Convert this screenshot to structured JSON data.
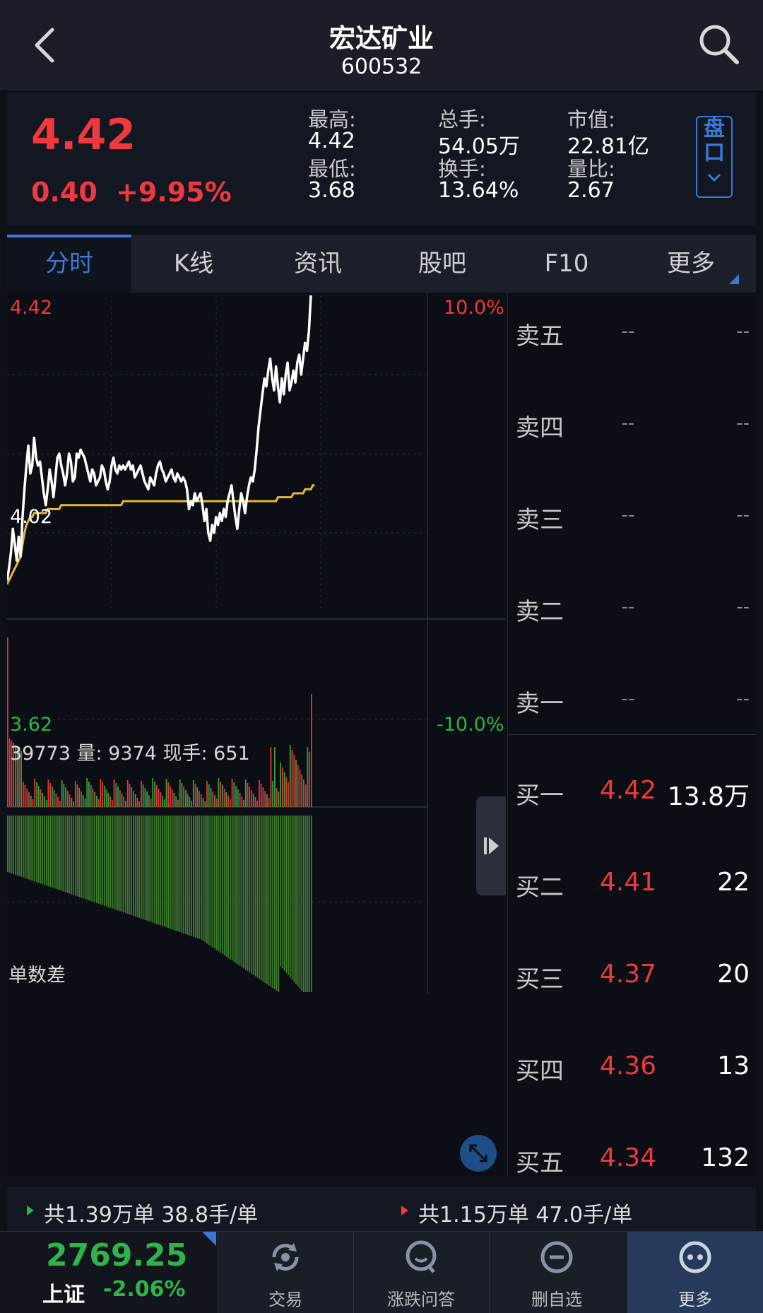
{
  "header": {
    "stock_name": "宏达矿业",
    "stock_code": "600532",
    "back_icon": "chevron-left-icon",
    "search_icon": "search-icon"
  },
  "quote": {
    "price": "4.42",
    "change": "0.40",
    "change_pct": "+9.95%",
    "stats": [
      {
        "label": "最高:",
        "value": "4.42"
      },
      {
        "label": "最低:",
        "value": "3.68"
      },
      {
        "label": "总手:",
        "value": "54.05万"
      },
      {
        "label": "换手:",
        "value": "13.64%"
      },
      {
        "label": "市值:",
        "value": "22.81亿"
      },
      {
        "label": "量比:",
        "value": "2.67"
      }
    ],
    "pankou_chars": [
      "盘",
      "口"
    ],
    "colors": {
      "up": "#f0393e",
      "down": "#2fb34a",
      "accent": "#3d78d8"
    }
  },
  "tabs": [
    "分时",
    "K线",
    "资讯",
    "股吧",
    "F10",
    "更多"
  ],
  "active_tab": "分时",
  "chart_data": {
    "type": "line",
    "axis": {
      "price_top": "4.42",
      "price_mid": "4.02",
      "price_bottom": "3.62",
      "pct_top": "10.0%",
      "pct_bottom": "-10.0%"
    },
    "ylim": [
      3.62,
      4.42
    ],
    "volume_header": "39773  量: 9374  现手: 651",
    "diff_header": "单数差",
    "price": [
      3.7,
      3.73,
      3.77,
      3.83,
      3.79,
      3.75,
      3.81,
      3.76,
      3.86,
      3.93,
      3.99,
      4.04,
      3.97,
      3.99,
      4.06,
      4.01,
      3.99,
      4.0,
      3.96,
      3.92,
      3.89,
      3.93,
      3.98,
      3.95,
      3.91,
      3.96,
      4.01,
      4.02,
      3.99,
      3.97,
      3.94,
      3.97,
      4.02,
      4.0,
      3.95,
      3.96,
      4.02,
      4.01,
      4.03,
      4.02,
      4.01,
      3.99,
      3.97,
      3.95,
      3.98,
      3.97,
      3.94,
      3.95,
      3.96,
      3.99,
      3.98,
      3.95,
      3.93,
      3.95,
      3.99,
      4.01,
      3.98,
      3.97,
      3.99,
      3.98,
      3.99,
      3.98,
      3.99,
      4.0,
      3.98,
      3.99,
      3.96,
      3.97,
      3.98,
      3.99,
      3.97,
      3.95,
      3.94,
      3.93,
      3.96,
      3.95,
      3.94,
      3.97,
      3.99,
      4.0,
      3.98,
      3.97,
      3.95,
      3.96,
      3.97,
      3.98,
      3.96,
      3.95,
      3.97,
      3.96,
      3.95,
      3.96,
      3.95,
      3.93,
      3.88,
      3.9,
      3.89,
      3.92,
      3.9,
      3.91,
      3.92,
      3.89,
      3.85,
      3.88,
      3.82,
      3.8,
      3.84,
      3.82,
      3.86,
      3.84,
      3.87,
      3.85,
      3.88,
      3.86,
      3.9,
      3.92,
      3.94,
      3.9,
      3.86,
      3.83,
      3.88,
      3.92,
      3.9,
      3.87,
      3.91,
      3.94,
      3.96,
      3.95,
      3.98,
      4.03,
      4.09,
      4.13,
      4.17,
      4.21,
      4.19,
      4.23,
      4.26,
      4.21,
      4.18,
      4.24,
      4.19,
      4.15,
      4.21,
      4.17,
      4.22,
      4.25,
      4.18,
      4.2,
      4.23,
      4.2,
      4.25,
      4.27,
      4.22,
      4.26,
      4.3,
      4.28,
      4.33,
      4.42
    ],
    "avg_price": [
      3.69,
      3.7,
      3.71,
      3.72,
      3.73,
      3.74,
      3.75,
      3.76,
      3.79,
      3.82,
      3.84,
      3.85,
      3.86,
      3.86,
      3.87,
      3.87,
      3.87,
      3.87,
      3.87,
      3.87,
      3.87,
      3.88,
      3.88,
      3.88,
      3.88,
      3.88,
      3.88,
      3.88,
      3.89,
      3.89,
      3.89,
      3.89,
      3.89,
      3.89,
      3.89,
      3.89,
      3.89,
      3.89,
      3.89,
      3.89,
      3.89,
      3.89,
      3.89,
      3.89,
      3.89,
      3.89,
      3.89,
      3.89,
      3.89,
      3.89,
      3.89,
      3.89,
      3.89,
      3.89,
      3.89,
      3.89,
      3.89,
      3.89,
      3.89,
      3.89,
      3.9,
      3.9,
      3.9,
      3.9,
      3.9,
      3.9,
      3.9,
      3.9,
      3.9,
      3.9,
      3.9,
      3.9,
      3.9,
      3.9,
      3.9,
      3.9,
      3.9,
      3.9,
      3.9,
      3.9,
      3.9,
      3.9,
      3.9,
      3.9,
      3.9,
      3.9,
      3.9,
      3.9,
      3.9,
      3.9,
      3.9,
      3.9,
      3.9,
      3.9,
      3.9,
      3.9,
      3.9,
      3.9,
      3.9,
      3.9,
      3.9,
      3.9,
      3.9,
      3.9,
      3.9,
      3.9,
      3.9,
      3.9,
      3.9,
      3.9,
      3.9,
      3.9,
      3.9,
      3.9,
      3.9,
      3.9,
      3.9,
      3.9,
      3.9,
      3.9,
      3.9,
      3.9,
      3.9,
      3.9,
      3.9,
      3.9,
      3.9,
      3.9,
      3.9,
      3.9,
      3.9,
      3.9,
      3.9,
      3.9,
      3.9,
      3.9,
      3.9,
      3.9,
      3.9,
      3.9,
      3.91,
      3.91,
      3.91,
      3.91,
      3.91,
      3.91,
      3.91,
      3.91,
      3.92,
      3.92,
      3.92,
      3.92,
      3.92,
      3.92,
      3.93,
      3.93,
      3.93,
      3.93,
      3.94,
      3.94
    ]
  },
  "order_book": {
    "sell": [
      {
        "label": "卖五",
        "price": "--",
        "vol": "--"
      },
      {
        "label": "卖四",
        "price": "--",
        "vol": "--"
      },
      {
        "label": "卖三",
        "price": "--",
        "vol": "--"
      },
      {
        "label": "卖二",
        "price": "--",
        "vol": "--"
      },
      {
        "label": "卖一",
        "price": "--",
        "vol": "--"
      }
    ],
    "buy": [
      {
        "label": "买一",
        "price": "4.42",
        "vol": "13.8万"
      },
      {
        "label": "买二",
        "price": "4.41",
        "vol": "22"
      },
      {
        "label": "买三",
        "price": "4.37",
        "vol": "20"
      },
      {
        "label": "买四",
        "price": "4.36",
        "vol": "13"
      },
      {
        "label": "买五",
        "price": "4.34",
        "vol": "132"
      }
    ]
  },
  "summary": {
    "sell_side": "共1.39万单  38.8手/单",
    "buy_side": "共1.15万单  47.0手/单"
  },
  "bottom_nav": {
    "index_value": "2769.25",
    "index_name": "上证",
    "index_change": "-2.06%",
    "items": [
      {
        "label": "交易",
        "icon": "refresh-icon"
      },
      {
        "label": "涨跌问答",
        "icon": "qa-icon"
      },
      {
        "label": "删自选",
        "icon": "minus-circle-icon"
      },
      {
        "label": "更多",
        "icon": "more-dots-icon"
      }
    ]
  }
}
